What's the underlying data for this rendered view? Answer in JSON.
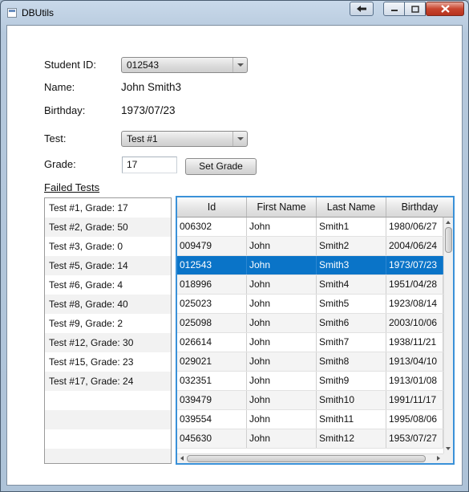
{
  "window": {
    "title": "DBUtils"
  },
  "form": {
    "student_id_label": "Student ID:",
    "student_id_value": "012543",
    "name_label": "Name:",
    "name_value": "John Smith3",
    "birthday_label": "Birthday:",
    "birthday_value": "1973/07/23",
    "test_label": "Test:",
    "test_value": "Test #1",
    "grade_label": "Grade:",
    "grade_value": "17",
    "set_grade_label": "Set Grade"
  },
  "failed_tests": {
    "label": "Failed Tests",
    "items": [
      "Test #1, Grade: 17",
      "Test #2, Grade: 50",
      "Test #3, Grade: 0",
      "Test #5, Grade: 14",
      "Test #6, Grade: 4",
      "Test #8, Grade: 40",
      "Test #9, Grade: 2",
      "Test #12, Grade: 30",
      "Test #15, Grade: 23",
      "Test #17, Grade: 24"
    ]
  },
  "table": {
    "columns": [
      "Id",
      "First Name",
      "Last Name",
      "Birthday"
    ],
    "selected_row": 2,
    "rows": [
      [
        "006302",
        "John",
        "Smith1",
        "1980/06/27"
      ],
      [
        "009479",
        "John",
        "Smith2",
        "2004/06/24"
      ],
      [
        "012543",
        "John",
        "Smith3",
        "1973/07/23"
      ],
      [
        "018996",
        "John",
        "Smith4",
        "1951/04/28"
      ],
      [
        "025023",
        "John",
        "Smith5",
        "1923/08/14"
      ],
      [
        "025098",
        "John",
        "Smith6",
        "2003/10/06"
      ],
      [
        "026614",
        "John",
        "Smith7",
        "1938/11/21"
      ],
      [
        "029021",
        "John",
        "Smith8",
        "1913/04/10"
      ],
      [
        "032351",
        "John",
        "Smith9",
        "1913/01/08"
      ],
      [
        "039479",
        "John",
        "Smith10",
        "1991/11/17"
      ],
      [
        "039554",
        "John",
        "Smith11",
        "1995/08/06"
      ],
      [
        "045630",
        "John",
        "Smith12",
        "1953/07/27"
      ]
    ]
  },
  "colors": {
    "selection": "#0a74c8",
    "focus_border": "#3a91d8",
    "close_button": "#c8452f"
  }
}
